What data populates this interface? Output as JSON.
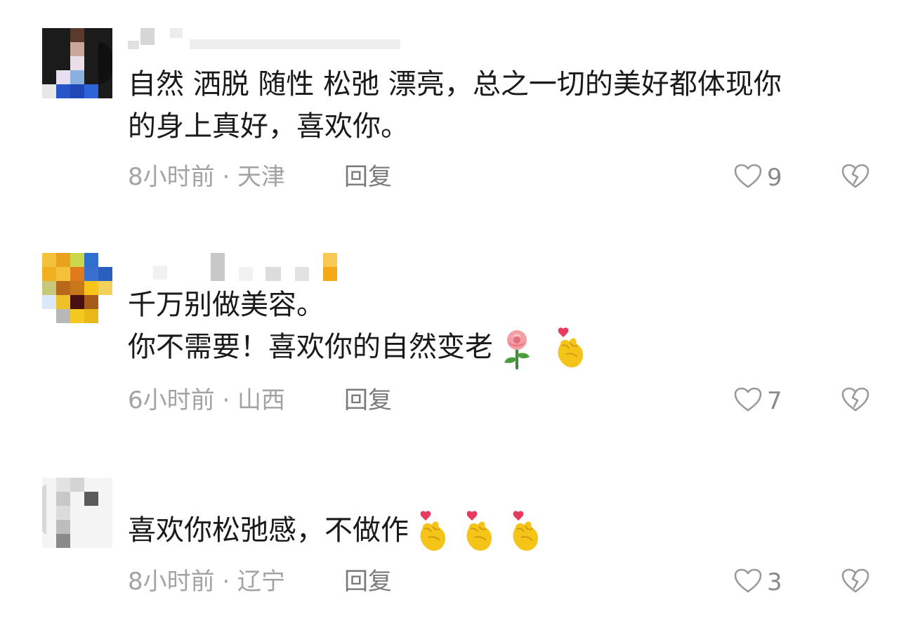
{
  "comments": [
    {
      "lines": [
        "自然 洒脱 随性 松弛 漂亮，总之一切的美好都体现你",
        "的身上真好，喜欢你。"
      ],
      "time": "8小时前 · 天津",
      "reply_label": "回复",
      "likes": "9"
    },
    {
      "lines": [
        "千万别做美容。",
        "你不需要！喜欢你的自然变老"
      ],
      "emojis": [
        "rose-emoji",
        "finger-heart-emoji"
      ],
      "time": "6小时前 · 山西",
      "reply_label": "回复",
      "likes": "7"
    },
    {
      "lines": [
        "喜欢你松弛感，不做作"
      ],
      "emojis": [
        "finger-heart-emoji",
        "finger-heart-emoji",
        "finger-heart-emoji"
      ],
      "time": "8小时前 · 辽宁",
      "reply_label": "回复",
      "likes": "3"
    }
  ],
  "icons": {
    "like": "heart-outline-icon",
    "dislike": "broken-heart-icon"
  },
  "colors": {
    "text": "#1a1a1a",
    "meta": "#a3a3a3",
    "reply": "#7a7a7a",
    "icon": "#9a9a9a"
  }
}
